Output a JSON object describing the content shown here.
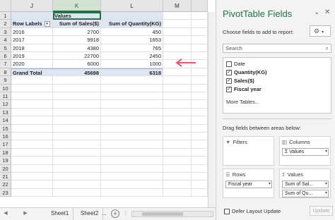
{
  "sheet": {
    "columns": [
      "J",
      "K",
      "L",
      "M"
    ],
    "rows": [
      "1",
      "2",
      "3",
      "4",
      "5",
      "6",
      "7",
      "8",
      "9",
      "10",
      "11",
      "12",
      "13",
      "14",
      "15",
      "16",
      "17",
      "18",
      "19",
      "20",
      "21",
      "22",
      "23"
    ],
    "pivot": {
      "values_header": "Values",
      "row_labels": "Row Labels",
      "col1_header": "Sum of Sales($)",
      "col2_header": "Sum of Quantity(KG)",
      "data": [
        {
          "year": "2016",
          "sales": "2700",
          "qty": "450"
        },
        {
          "year": "2017",
          "sales": "9918",
          "qty": "1653"
        },
        {
          "year": "2018",
          "sales": "4380",
          "qty": "765"
        },
        {
          "year": "2019",
          "sales": "22700",
          "qty": "2450"
        },
        {
          "year": "2020",
          "sales": "6000",
          "qty": "1000"
        }
      ],
      "grand_total_label": "Grand Total",
      "grand_total_sales": "45698",
      "grand_total_qty": "6318"
    }
  },
  "tabs": {
    "sheet1": "Sheet1",
    "sheet2": "Sheet2",
    "more": "..."
  },
  "pane": {
    "title": "PivotTable Fields",
    "subtitle": "Choose fields to add to report:",
    "search_placeholder": "Search",
    "fields": [
      {
        "label": "Date",
        "checked": false
      },
      {
        "label": "Quantity(KG)",
        "checked": true
      },
      {
        "label": "Sales($)",
        "checked": true
      },
      {
        "label": "Fiscal year",
        "checked": true
      }
    ],
    "more_tables": "More Tables...",
    "drag_hint": "Drag fields between areas below:",
    "filters_label": "Filters",
    "columns_label": "Columns",
    "columns_chip": "Values",
    "rows_label": "Rows",
    "rows_chip": "Fiscal year",
    "values_label": "Values",
    "values_chip1": "Sum of Sal...",
    "values_chip2": "Sum of Qu...",
    "defer_label": "Defer Layout Update",
    "update_label": "Update"
  },
  "icons": {
    "close": "close-icon",
    "dropdown": "chevron-down-icon",
    "gear": "gear-icon",
    "search": "search-icon",
    "filter": "filter-icon",
    "columns": "columns-icon",
    "rows": "rows-icon",
    "values": "sigma-icon"
  },
  "colors": {
    "accent": "#217346",
    "pivot_header": "#dde6f3",
    "arrow": "#e05a6a"
  }
}
